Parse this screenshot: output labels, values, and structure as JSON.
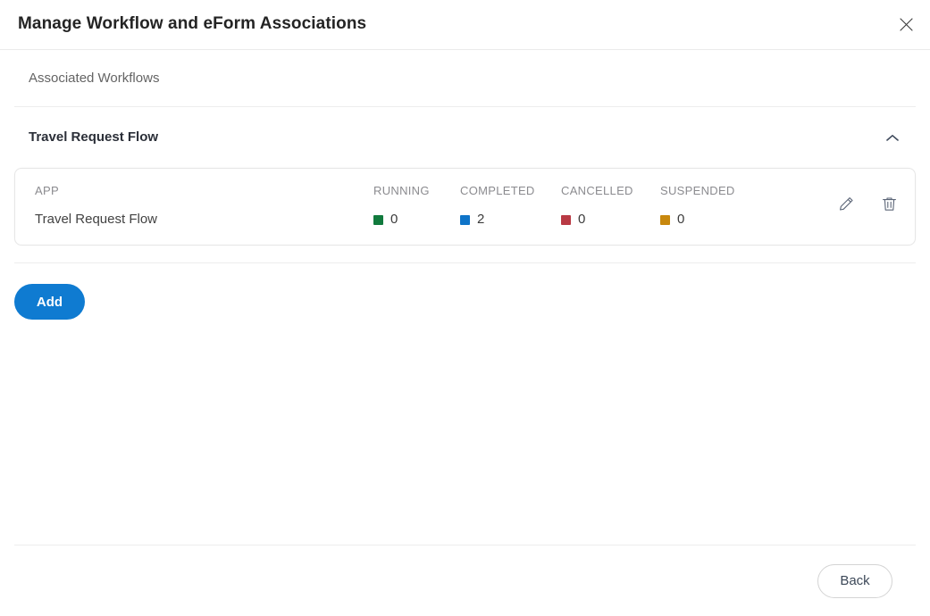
{
  "dialog": {
    "title": "Manage Workflow and eForm Associations",
    "close_icon": "close-icon"
  },
  "body": {
    "section_label": "Associated Workflows",
    "group": {
      "title": "Travel Request Flow",
      "collapse_icon": "chevron-up-icon"
    },
    "card": {
      "columns": [
        {
          "key": "app",
          "header": "APP"
        },
        {
          "key": "running",
          "header": "RUNNING"
        },
        {
          "key": "completed",
          "header": "COMPLETED"
        },
        {
          "key": "cancelled",
          "header": "CANCELLED"
        },
        {
          "key": "suspended",
          "header": "SUSPENDED"
        }
      ],
      "row": {
        "app": "Travel Request Flow",
        "running": "0",
        "completed": "2",
        "cancelled": "0",
        "suspended": "0"
      },
      "status_colors": {
        "running": "#117a3d",
        "completed": "#0f74c8",
        "cancelled": "#b93a44",
        "suspended": "#c8880e"
      },
      "actions": {
        "edit_icon": "pencil-icon",
        "delete_icon": "trash-icon"
      }
    },
    "add_label": "Add"
  },
  "footer": {
    "back_label": "Back"
  }
}
